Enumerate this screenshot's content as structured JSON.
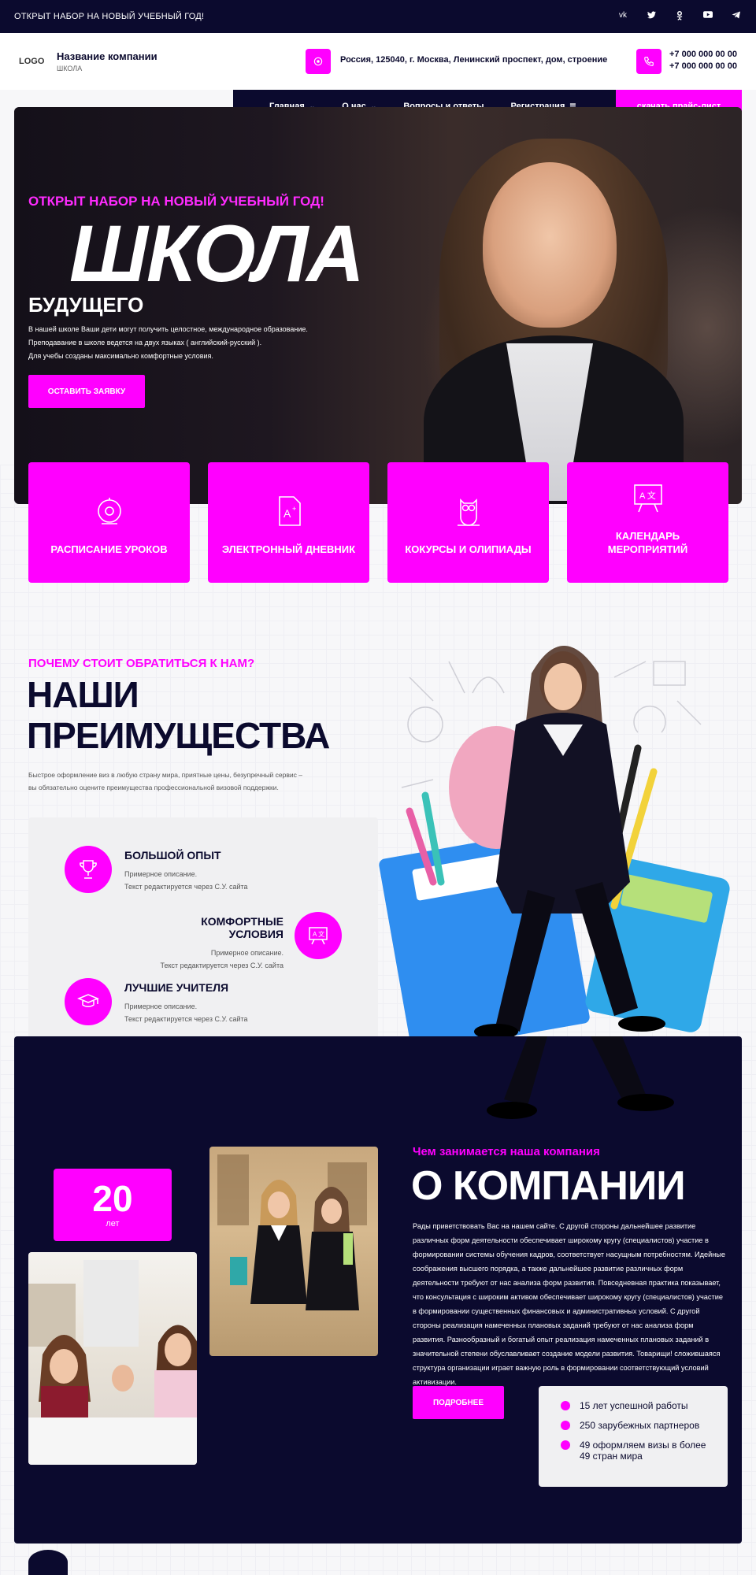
{
  "topbar": {
    "announcement": "ОТКРЫТ НАБОР НА НОВЫЙ УЧЕБНЫЙ ГОД!",
    "socials": [
      "vk-icon",
      "twitter-icon",
      "odnoklassniki-icon",
      "youtube-icon",
      "telegram-icon"
    ]
  },
  "header": {
    "logo": "LOGO",
    "company_name": "Название компании",
    "company_sub": "ШКОЛА",
    "address": "Россия, 125040, г. Москва, Ленинский проспект, дом, строение",
    "phone1": "+7 000 000 00 00",
    "phone2": "+7 000 000 00 00"
  },
  "nav": {
    "items": [
      {
        "label": "Главная"
      },
      {
        "label": "О нас"
      },
      {
        "label": "Вопросы и ответы"
      },
      {
        "label": "Регистрация"
      }
    ],
    "price_button": "скачать прайс-лист"
  },
  "hero": {
    "pretitle": "ОТКРЫТ НАБОР НА НОВЫЙ УЧЕБНЫЙ ГОД!",
    "title": "ШКОЛА",
    "subtitle": "БУДУЩЕГО",
    "line1": "В нашей школе Ваши дети могут получить целостное, международное образование.",
    "line2": "Преподавание в школе ведется на двух языках ( английский-русский ).",
    "line3": "Для учебы созданы максимально комфортные условия.",
    "button": "ОСТАВИТЬ ЗАЯВКУ"
  },
  "cards": [
    {
      "label": "РАСПИСАНИЕ УРОКОВ",
      "icon": "bell-icon"
    },
    {
      "label": "ЭЛЕКТРОННЫЙ ДНЕВНИК",
      "icon": "grade-paper-icon"
    },
    {
      "label": "КОКУРСЫ И ОЛИПИАДЫ",
      "icon": "owl-icon"
    },
    {
      "label": "КАЛЕНДАРЬ МЕРОПРИЯТИЙ",
      "icon": "board-icon"
    }
  ],
  "advantages": {
    "pretitle": "ПОЧЕМУ СТОИТ ОБРАТИТЬСЯ К НАМ?",
    "title_line1": "НАШИ",
    "title_line2": "ПРЕИМУЩЕСТВА",
    "desc_line1": "Быстрое оформление виз в любую страну мира, приятные цены, безупречный сервис –",
    "desc_line2": "вы обязательно оцените преимущества профессиональной визовой поддержки.",
    "items": [
      {
        "title": "БОЛЬШОЙ ОПЫТ",
        "d1": "Примерное описание.",
        "d2": "Текст редактируется через С.У. сайта",
        "icon": "trophy-icon"
      },
      {
        "title": "КОМФОРТНЫЕ УСЛОВИЯ",
        "d1": "Примерное описание.",
        "d2": "Текст редактируется через С.У. сайта",
        "icon": "board-icon"
      },
      {
        "title": "ЛУЧШИЕ УЧИТЕЛЯ",
        "d1": "Примерное описание.",
        "d2": "Текст редактируется через С.У. сайта",
        "icon": "graduation-cap-icon"
      }
    ]
  },
  "about": {
    "years_number": "20",
    "years_unit": "лет",
    "pretitle": "Чем занимается наша компания",
    "title": "О КОМПАНИИ",
    "text": "Рады приветствовать Вас на нашем сайте. С другой стороны дальнейшее развитие различных форм деятельности обеспечивает широкому кругу (специалистов) участие в формировании системы обучения кадров, соответствует насущным потребностям. Идейные соображения высшего порядка, а также дальнейшее развитие различных форм деятельности требуют от нас анализа форм развития. Повседневная практика показывает, что консультация с широким активом обеспечивает широкому кругу (специалистов) участие в формировании существенных финансовых и административных условий. С другой стороны реализация намеченных плановых заданий требуют от нас анализа форм развития. Разнообразный и богатый опыт реализация намеченных плановых заданий в значительной степени обуславливает создание модели развития. Товарищи! сложившаяся структура организации играет важную роль в формировании соответствующий условий активизации.",
    "button": "ПОДРОБНЕЕ",
    "stats": [
      "15 лет успешной работы",
      "250 зарубежных партнеров",
      "49 оформляем визы в более 49 стран мира"
    ]
  },
  "colors": {
    "accent": "#ff00ff",
    "dark": "#0b0a2e",
    "light": "#f0f0f2"
  }
}
